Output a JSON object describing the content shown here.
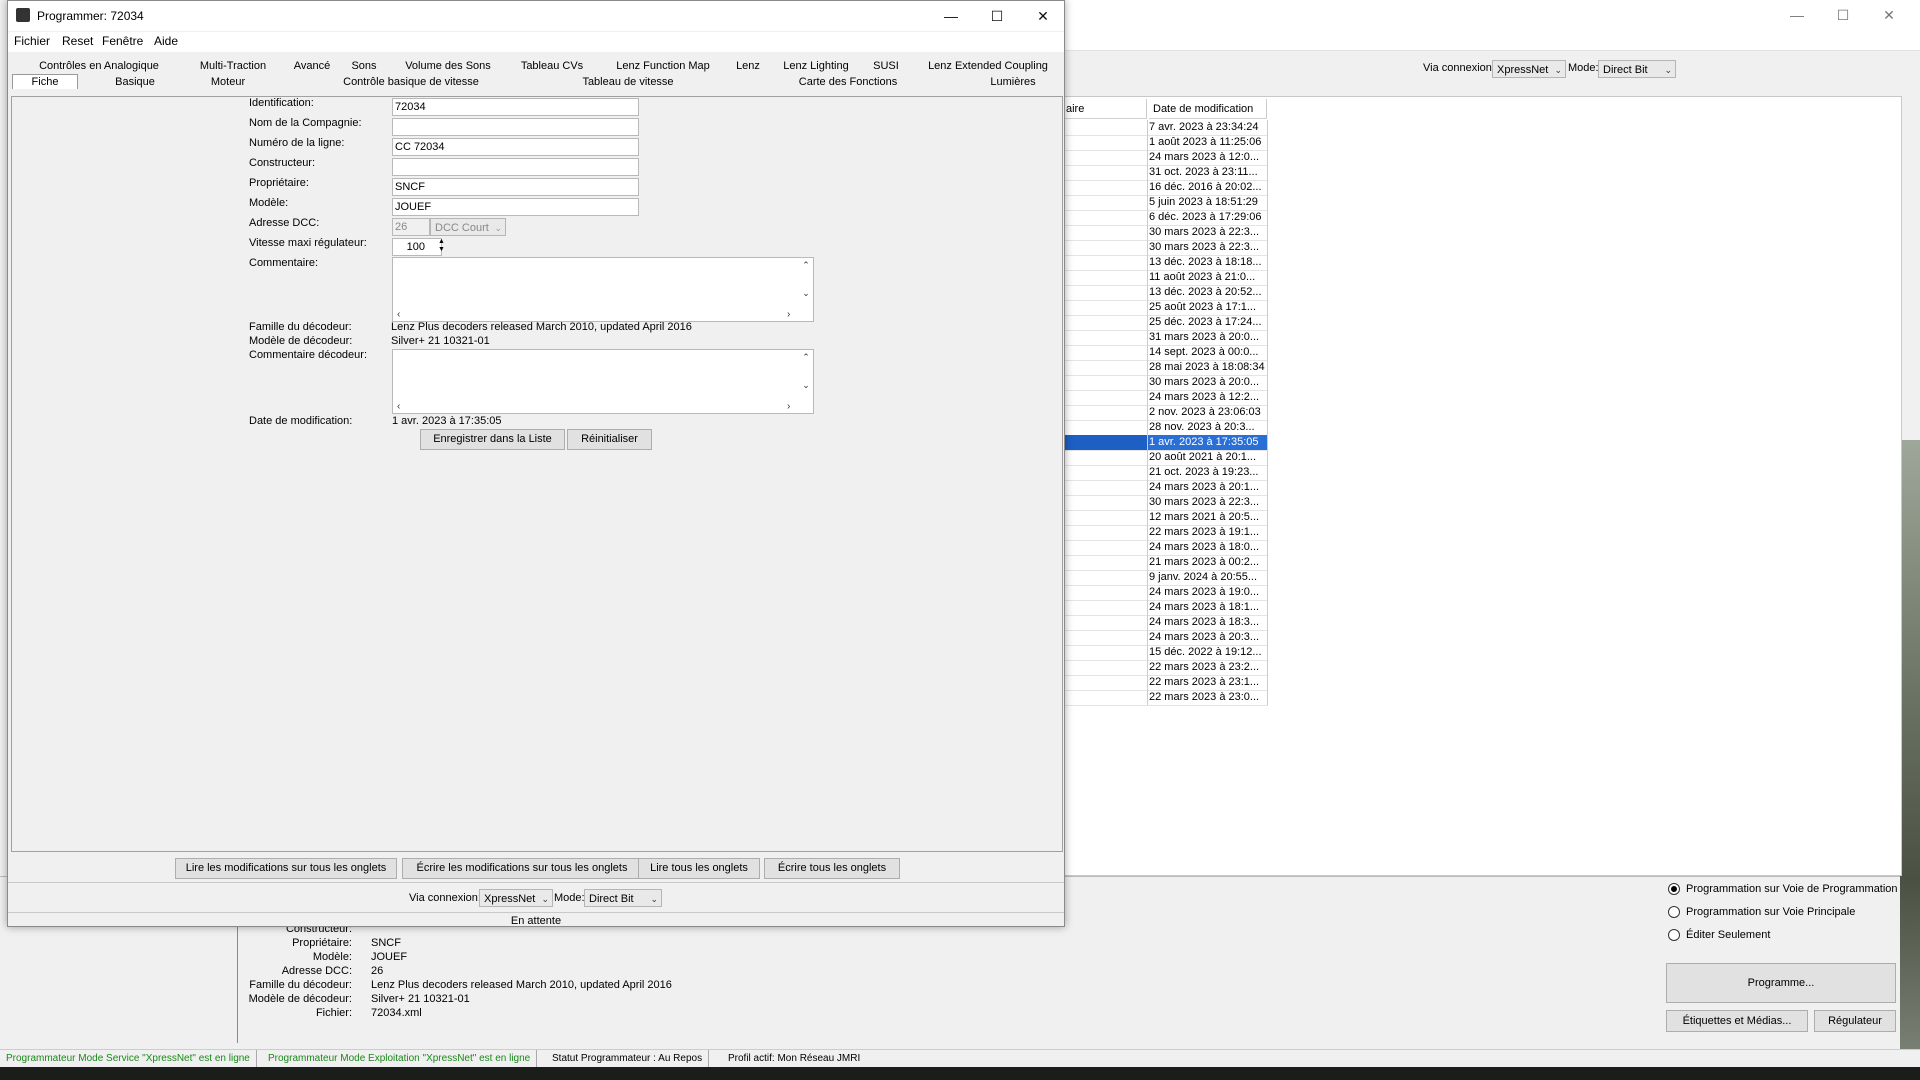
{
  "background": {
    "connection_label": "Via connexion:",
    "connection_value": "XpressNet",
    "mode_label": "Mode:",
    "mode_value": "Direct Bit",
    "table_col1": "aire",
    "table_col2": "Date de modification",
    "rows": [
      "7 avr. 2023 à 23:34:24",
      "1 août 2023 à 11:25:06",
      "24 mars 2023 à 12:0...",
      "31 oct. 2023 à 23:11...",
      "16 déc. 2016 à 20:02...",
      "5 juin 2023 à 18:51:29",
      "6 déc. 2023 à 17:29:06",
      "30 mars 2023 à 22:3...",
      "30 mars 2023 à 22:3...",
      "13 déc. 2023 à 18:18...",
      "11 août 2023 à 21:0...",
      "13 déc. 2023 à 20:52...",
      "25 août 2023 à 17:1...",
      "25 déc. 2023 à 17:24...",
      "31 mars 2023 à 20:0...",
      "14 sept. 2023 à 00:0...",
      "28 mai 2023 à 18:08:34",
      "30 mars 2023 à 20:0...",
      "24 mars 2023 à 12:2...",
      "2 nov. 2023 à 23:06:03",
      "28 nov. 2023 à 20:3...",
      "1 avr. 2023 à 17:35:05",
      "20 août 2021 à 20:1...",
      "21 oct. 2023 à 19:23...",
      "24 mars 2023 à 20:1...",
      "30 mars 2023 à 22:3...",
      "12 mars 2021 à 20:5...",
      "22 mars 2023 à 19:1...",
      "24 mars 2023 à 18:0...",
      "21 mars 2023 à 00:2...",
      "9 janv. 2024 à 20:55...",
      "24 mars 2023 à 19:0...",
      "24 mars 2023 à 18:1...",
      "24 mars 2023 à 18:3...",
      "24 mars 2023 à 20:3...",
      "15 déc. 2022 à 19:12...",
      "22 mars 2023 à 23:2...",
      "22 mars 2023 à 23:1...",
      "22 mars 2023 à 23:0..."
    ],
    "selected_row": 21,
    "radio_prog_track": "Programmation sur Voie de Programmation",
    "radio_main_track": "Programmation sur Voie Principale",
    "radio_edit_only": "Éditer Seulement",
    "program_button": "Programme...",
    "labels_button": "Étiquettes et Médias...",
    "throttle_button": "Régulateur",
    "details": [
      {
        "k": "Constructeur:",
        "v": ""
      },
      {
        "k": "Propriétaire:",
        "v": "SNCF"
      },
      {
        "k": "Modèle:",
        "v": "JOUEF"
      },
      {
        "k": "Adresse DCC:",
        "v": "26"
      },
      {
        "k": "Famille du décodeur:",
        "v": "Lenz Plus decoders released March 2010, updated April 2016"
      },
      {
        "k": "Modèle de décodeur:",
        "v": "Silver+ 21 10321-01"
      },
      {
        "k": "Fichier:",
        "v": "72034.xml"
      }
    ]
  },
  "statusbar": {
    "service": "Programmateur Mode Service \"XpressNet\" est en ligne",
    "ops": "Programmateur Mode Exploitation \"XpressNet\" est en ligne",
    "status": "Statut Programmateur : Au Repos",
    "profile": "Profil actif: Mon Réseau JMRI"
  },
  "dialog": {
    "title": "Programmer: 72034",
    "menus": [
      "Fichier",
      "Reset",
      "Fenêtre",
      "Aide"
    ],
    "tabs_row1": [
      "Contrôles en Analogique",
      "Multi-Traction",
      "Avancé",
      "Sons",
      "Volume des Sons",
      "Tableau CVs",
      "Lenz Function Map",
      "Lenz",
      "Lenz Lighting",
      "SUSI",
      "Lenz Extended Coupling"
    ],
    "tabs_row2": [
      "Fiche",
      "Basique",
      "Moteur",
      "Contrôle basique de vitesse",
      "Tableau de vitesse",
      "Carte des Fonctions",
      "Lumières"
    ],
    "form": {
      "id_label": "Identification:",
      "id_value": "72034",
      "company_label": "Nom de la Compagnie:",
      "company_value": "",
      "road_label": "Numéro de la ligne:",
      "road_value": "CC 72034",
      "maker_label": "Constructeur:",
      "maker_value": "",
      "owner_label": "Propriétaire:",
      "owner_value": "SNCF",
      "model_label": "Modèle:",
      "model_value": "JOUEF",
      "dcc_label": "Adresse DCC:",
      "dcc_value": "26",
      "dcc_type": "DCC Court",
      "speed_label": "Vitesse maxi régulateur:",
      "speed_value": "100 %",
      "comment_label": "Commentaire:",
      "family_label": "Famille du décodeur:",
      "family_value": "Lenz Plus decoders released March 2010, updated April 2016",
      "decmodel_label": "Modèle de décodeur:",
      "decmodel_value": "Silver+ 21 10321-01",
      "deccomment_label": "Commentaire décodeur:",
      "date_label": "Date de modification:",
      "date_value": "1 avr. 2023 à 17:35:05",
      "save_button": "Enregistrer dans la Liste",
      "reset_button": "Réinitialiser"
    },
    "read_changes": "Lire les modifications sur tous les onglets",
    "write_changes": "Écrire les modifications sur tous les onglets",
    "read_all": "Lire tous les onglets",
    "write_all": "Écrire tous les onglets",
    "connection_label": "Via connexion:",
    "connection_value": "XpressNet",
    "mode_label": "Mode:",
    "mode_value": "Direct Bit",
    "status": "En attente"
  }
}
